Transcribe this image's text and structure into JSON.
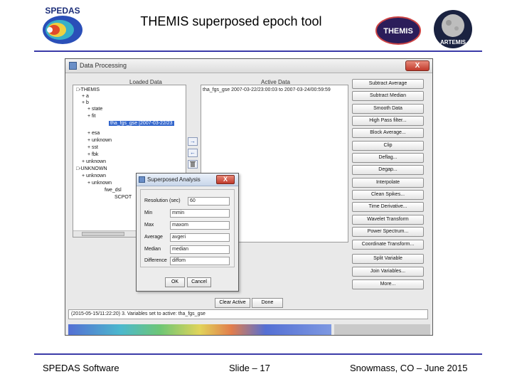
{
  "slide": {
    "title": "THEMIS superposed epoch tool",
    "footer_left": "SPEDAS Software",
    "footer_center": "Slide – 17",
    "footer_right": "Snowmass, CO – June 2015",
    "logos": {
      "spedas": "SPEDAS",
      "themis": "THEMIS",
      "artemis": "ARTEMIS"
    },
    "rule_color": "#3b3ba8"
  },
  "window": {
    "title": "Data Processing",
    "close_label": "X",
    "loaded_label": "Loaded Data",
    "active_label": "Active Data",
    "tree": [
      "□-THEMIS",
      "+ a",
      "+ b",
      "+ state",
      "+ fit",
      "tha_fgs_gse [2007-03-22/23",
      "+ esa",
      "+ unknown",
      "+ sst",
      "+ fbk",
      "+ unknown",
      "□-UNKNOWN",
      "+ unknown",
      "+ unknown",
      "fwe_dsl",
      "SCPOT"
    ],
    "active_data": [
      "tha_fgs_gse   2007-03-22/23:00:03 to 2007-03-24/00:59:59"
    ],
    "arrow_buttons": [
      "→",
      "←",
      "trash-icon"
    ],
    "side_buttons": [
      "Subtract Average",
      "Subtract Median",
      "Smooth Data",
      "High Pass filter...",
      "Block Average...",
      "Clip",
      "Deflag...",
      "Degap...",
      "Interpolate",
      "Clean Spikes...",
      "Time Derivative...",
      "Wavelet Transform",
      "Power Spectrum...",
      "Coordinate Transform...",
      "Split Variable",
      "Join Variables...",
      "More..."
    ],
    "bottom_buttons": [
      "Clear Active",
      "Done"
    ],
    "status": "(2015-05-15/11:22:20) 3. Variables set to active: tha_fgs_gse"
  },
  "dialog": {
    "title": "Superposed Analysis",
    "close_label": "X",
    "fields": [
      {
        "label": "Resolution (sec)",
        "value": "60"
      },
      {
        "label": "Min",
        "value": "mmin"
      },
      {
        "label": "Max",
        "value": "maxom"
      },
      {
        "label": "Average",
        "value": "avgeri"
      },
      {
        "label": "Median",
        "value": "median"
      },
      {
        "label": "Difference",
        "value": "diffom"
      }
    ],
    "ok_label": "OK",
    "cancel_label": "Cancel"
  }
}
